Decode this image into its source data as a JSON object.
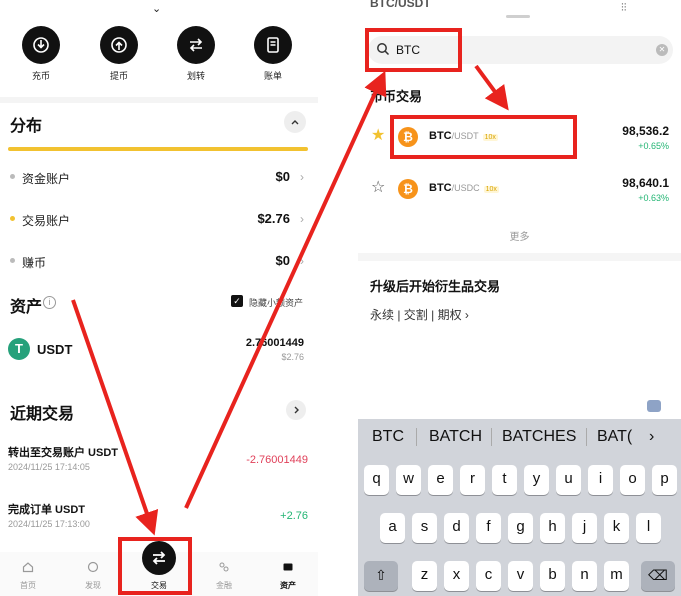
{
  "left": {
    "actions": [
      {
        "icon": "deposit-icon",
        "label": "充币"
      },
      {
        "icon": "withdraw-icon",
        "label": "提币"
      },
      {
        "icon": "transfer-icon",
        "label": "划转"
      },
      {
        "icon": "bill-icon",
        "label": "账单"
      }
    ],
    "distribution": {
      "title": "分布",
      "rows": [
        {
          "name": "资金账户",
          "value": "$0"
        },
        {
          "name": "交易账户",
          "value": "$2.76"
        },
        {
          "name": "赚币",
          "value": "$0"
        }
      ]
    },
    "assets": {
      "title": "资产",
      "hide_small_label": "隐藏小额资产",
      "coin": {
        "symbol": "USDT",
        "amount": "2.76001449",
        "usd": "$2.76",
        "icon_letter": "T"
      }
    },
    "recent": {
      "title": "近期交易",
      "items": [
        {
          "title": "转出至交易账户 USDT",
          "time": "2024/11/25 17:14:05",
          "amount": "-2.76001449"
        },
        {
          "title": "完成订单 USDT",
          "time": "2024/11/25 17:13:00",
          "amount": "+2.76"
        }
      ]
    },
    "tabs": [
      {
        "label": "首页"
      },
      {
        "label": "发现"
      },
      {
        "label": "交易"
      },
      {
        "label": "金融"
      },
      {
        "label": "资产"
      }
    ]
  },
  "right": {
    "top_title": "BTC/USDT",
    "search": {
      "value": "BTC"
    },
    "category_title": "币币交易",
    "results": [
      {
        "base": "BTC",
        "quote": "/USDT",
        "leverage": "10x",
        "price": "98,536.2",
        "change": "+0.65%",
        "starred": true
      },
      {
        "base": "BTC",
        "quote": "/USDC",
        "leverage": "10x",
        "price": "98,640.1",
        "change": "+0.63%",
        "starred": false
      }
    ],
    "more_label": "更多",
    "upgrade_title": "升级后开始衍生品交易",
    "derivatives": "永续 | 交割 | 期权 ›",
    "suggestions": [
      "BTC",
      "BATCH",
      "BATCHES",
      "BAT("
    ],
    "keyboard": {
      "row1": [
        "q",
        "w",
        "e",
        "r",
        "t",
        "y",
        "u",
        "i",
        "o",
        "p"
      ],
      "row2": [
        "a",
        "s",
        "d",
        "f",
        "g",
        "h",
        "j",
        "k",
        "l"
      ],
      "row3": [
        "z",
        "x",
        "c",
        "v",
        "b",
        "n",
        "m"
      ]
    }
  },
  "colors": {
    "accent": "#f2c230",
    "annotation": "#e8231e",
    "up": "#22b573",
    "down": "#e0415a",
    "btc": "#f7931a",
    "usdt": "#26a17b"
  }
}
